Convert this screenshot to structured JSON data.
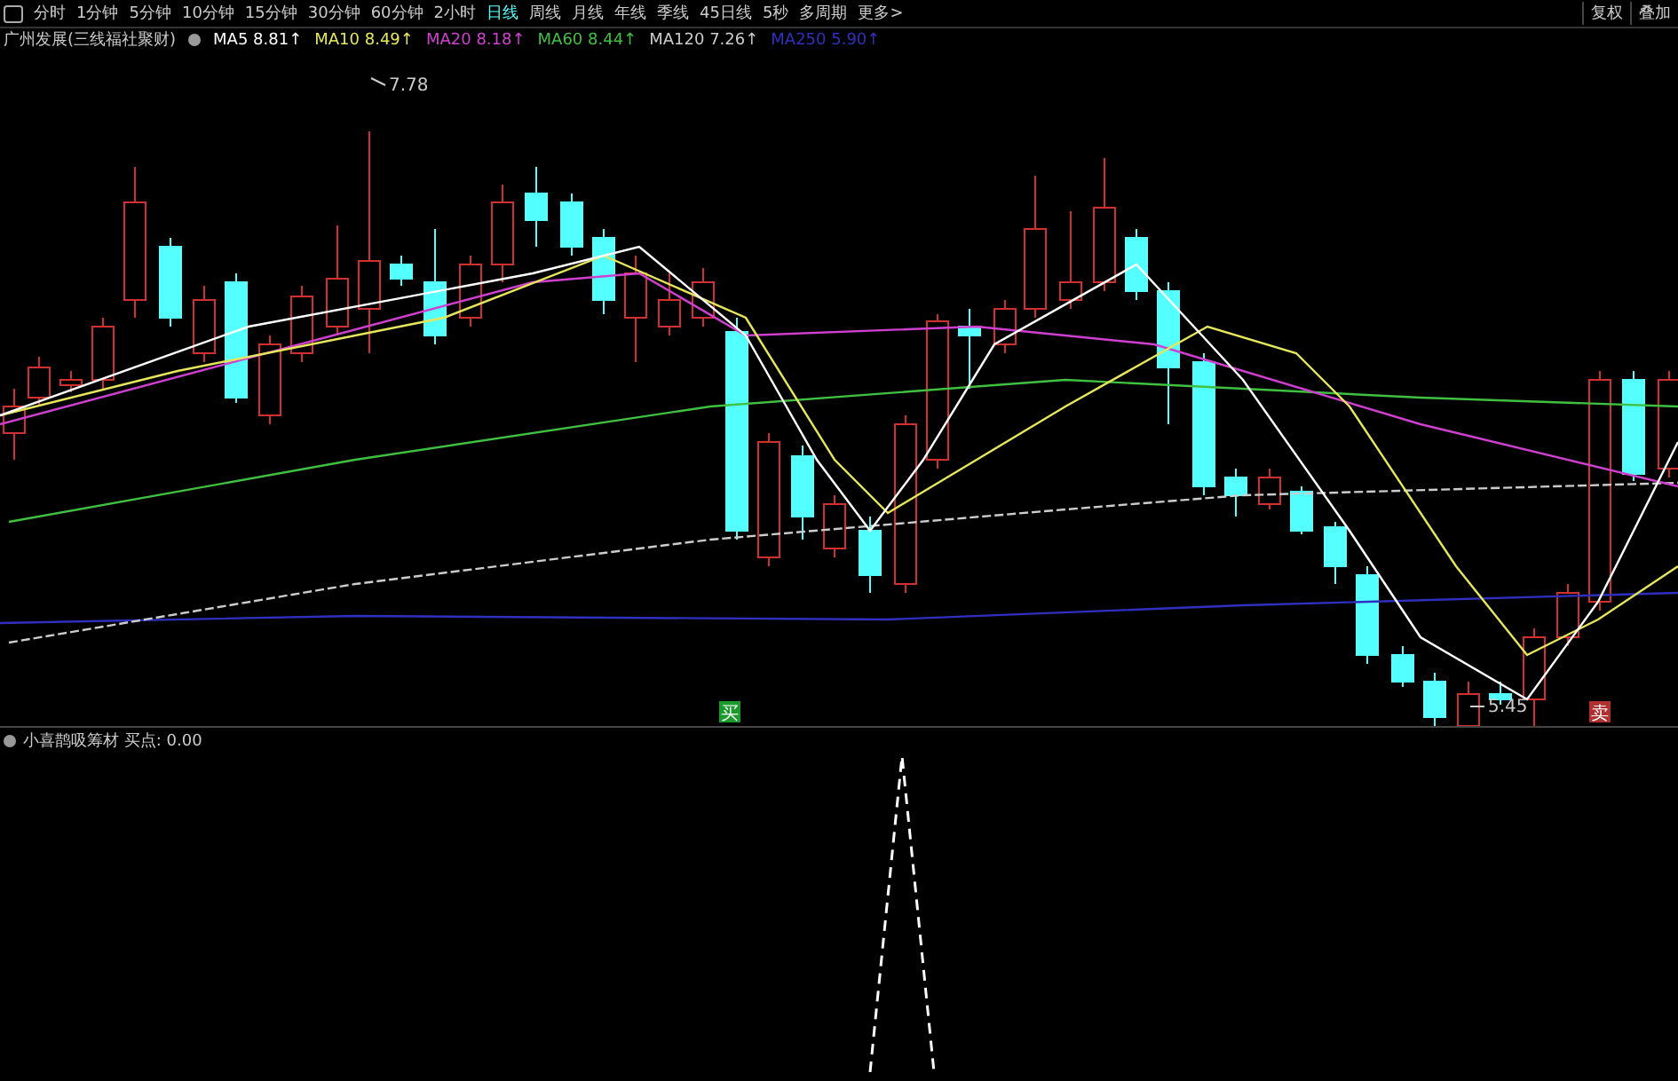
{
  "toolbar": {
    "tabs": [
      {
        "label": "分时",
        "selected": false
      },
      {
        "label": "1分钟",
        "selected": false
      },
      {
        "label": "5分钟",
        "selected": false
      },
      {
        "label": "10分钟",
        "selected": false
      },
      {
        "label": "15分钟",
        "selected": false
      },
      {
        "label": "30分钟",
        "selected": false
      },
      {
        "label": "60分钟",
        "selected": false
      },
      {
        "label": "2小时",
        "selected": false
      },
      {
        "label": "日线",
        "selected": true
      },
      {
        "label": "周线",
        "selected": false
      },
      {
        "label": "月线",
        "selected": false
      },
      {
        "label": "年线",
        "selected": false
      },
      {
        "label": "季线",
        "selected": false
      },
      {
        "label": "45日线",
        "selected": false
      },
      {
        "label": "5秒",
        "selected": false
      },
      {
        "label": "多周期",
        "selected": false
      },
      {
        "label": "更多>",
        "selected": false
      }
    ],
    "buttons": [
      "复权",
      "叠加"
    ]
  },
  "main_chart": {
    "title": "广州发展(三线福社聚财)",
    "legend": [
      {
        "name": "MA5",
        "value": "8.81↑",
        "color": "#ffffff"
      },
      {
        "name": "MA10",
        "value": "8.49↑",
        "color": "#e6e65a"
      },
      {
        "name": "MA20",
        "value": "8.18↑",
        "color": "#d040d0"
      },
      {
        "name": "MA60",
        "value": "8.44↑",
        "color": "#40c040"
      },
      {
        "name": "MA120",
        "value": "7.26↑",
        "color": "#cccccc"
      },
      {
        "name": "MA250",
        "value": "5.90↑",
        "color": "#3030c0"
      }
    ],
    "high_label": "7.78",
    "low_label": "5.45",
    "signals": [
      {
        "label": "买",
        "color": "#1a9a2a"
      },
      {
        "label": "卖",
        "color": "#b03030"
      }
    ]
  },
  "indicator": {
    "title": "小喜鹊吸筹材 买点: 0.00"
  }
}
